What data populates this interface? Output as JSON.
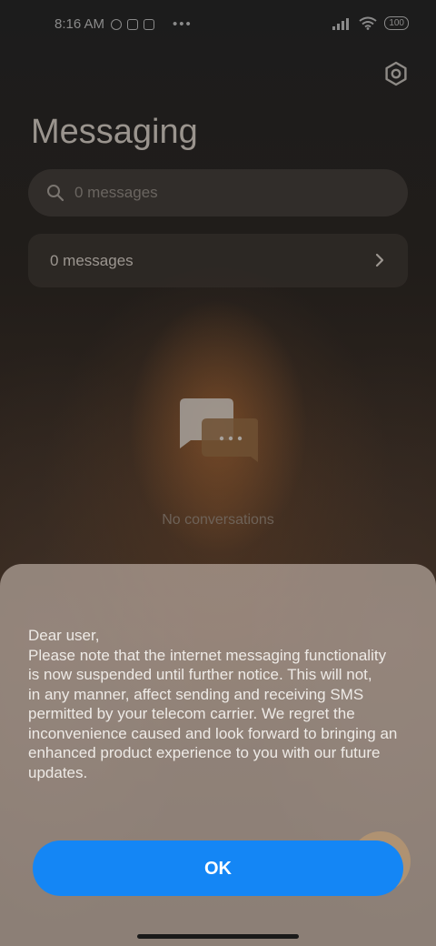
{
  "status_bar": {
    "time": "8:16 AM",
    "battery": "100",
    "more": "•••"
  },
  "header": {
    "title": "Messaging",
    "settings_icon": "gear-icon"
  },
  "search": {
    "placeholder": "0 messages",
    "icon": "search-icon"
  },
  "notice_row": {
    "label": "0 messages",
    "icon": "chevron-right-icon"
  },
  "empty_state": {
    "icon": "chat-bubbles-icon",
    "text": "No conversations"
  },
  "dialog": {
    "message_lines": [
      "Dear user,",
      "Please note that the internet messaging functionality",
      "is now suspended until further notice. This will not,",
      "in any manner, affect sending and receiving SMS",
      "permitted by your telecom carrier. We regret the",
      "inconvenience caused and look forward to bringing an",
      "enhanced product experience to you with our future",
      "updates."
    ],
    "ok_label": "OK"
  },
  "colors": {
    "accent": "#1486f5"
  }
}
